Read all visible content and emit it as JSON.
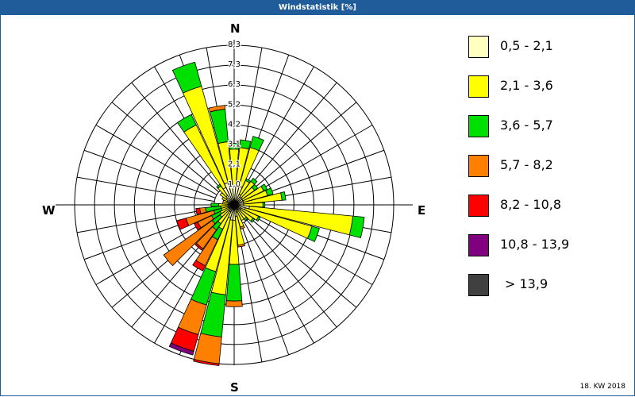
{
  "title": "Windstatistik [%]",
  "footer": "18. KW 2018",
  "chart_data": {
    "type": "windrose",
    "title": "Windstatistik [%]",
    "compass": {
      "n": "N",
      "e": "E",
      "s": "S",
      "w": "W"
    },
    "rmax": 8.3,
    "ring_labels": [
      "1,0",
      "2,1",
      "3,1",
      "4,2",
      "5,2",
      "6,3",
      "7,3",
      "8,3"
    ],
    "ring_values": [
      1.04,
      2.08,
      3.11,
      4.15,
      5.19,
      6.23,
      7.26,
      8.3
    ],
    "classes": [
      {
        "label": "0,5 - 2,1",
        "color": "#ffffc0"
      },
      {
        "label": "2,1 - 3,6",
        "color": "#ffff00"
      },
      {
        "label": "3,6 - 5,7",
        "color": "#00e000"
      },
      {
        "label": "5,7 - 8,2",
        "color": "#ff8000"
      },
      {
        "label": "8,2 - 10,8",
        "color": "#ff0000"
      },
      {
        "label": "10,8 - 13,9",
        "color": "#800080"
      },
      {
        "label": "> 13,9",
        "color": "#404040"
      }
    ],
    "directions_deg": [
      0,
      10,
      20,
      30,
      40,
      50,
      60,
      70,
      80,
      90,
      100,
      110,
      120,
      130,
      140,
      150,
      160,
      170,
      180,
      190,
      200,
      210,
      220,
      230,
      240,
      250,
      260,
      270,
      280,
      290,
      300,
      310,
      320,
      330,
      340,
      350
    ],
    "values_by_class": [
      [
        1.0,
        1.9,
        0.3,
        0,
        0,
        0,
        0
      ],
      [
        1.0,
        2.0,
        0.4,
        0,
        0,
        0,
        0
      ],
      [
        1.0,
        2.1,
        0.6,
        0,
        0,
        0,
        0
      ],
      [
        0.6,
        0.8,
        0.1,
        0,
        0,
        0,
        0
      ],
      [
        0.5,
        1.0,
        0.2,
        0,
        0,
        0,
        0
      ],
      [
        0.5,
        0.8,
        0.2,
        0,
        0,
        0,
        0
      ],
      [
        0.5,
        1.2,
        0.2,
        0,
        0,
        0,
        0
      ],
      [
        0.5,
        1.3,
        0.3,
        0,
        0,
        0,
        0
      ],
      [
        0.5,
        2.0,
        0.2,
        0,
        0,
        0,
        0
      ],
      [
        0.5,
        1.0,
        0.1,
        0,
        0,
        0,
        0
      ],
      [
        0.8,
        5.4,
        0.6,
        0,
        0,
        0,
        0
      ],
      [
        0.6,
        3.6,
        0.4,
        0,
        0,
        0,
        0
      ],
      [
        0.4,
        1.0,
        0.1,
        0,
        0,
        0,
        0
      ],
      [
        0.4,
        0.8,
        0.1,
        0,
        0,
        0,
        0
      ],
      [
        0.3,
        0.6,
        0.1,
        0,
        0,
        0,
        0
      ],
      [
        0.3,
        0.6,
        0,
        0,
        0,
        0,
        0
      ],
      [
        0.4,
        0.8,
        0,
        0.1,
        0,
        0,
        0
      ],
      [
        0.6,
        1.5,
        0,
        0.1,
        0,
        0,
        0
      ],
      [
        0.8,
        2.3,
        1.9,
        0.3,
        0,
        0,
        0
      ],
      [
        0.8,
        3.9,
        2.2,
        1.4,
        0.1,
        0,
        0
      ],
      [
        0.7,
        2.9,
        1.8,
        1.6,
        0.9,
        0.2,
        0
      ],
      [
        0.4,
        1.0,
        0.6,
        1.5,
        0.3,
        0,
        0
      ],
      [
        0.4,
        0.8,
        0.4,
        1.2,
        0.1,
        0,
        0
      ],
      [
        0.3,
        0.6,
        0.5,
        3.1,
        0,
        0,
        0
      ],
      [
        0.3,
        0.5,
        0.5,
        0.8,
        0.2,
        0,
        0
      ],
      [
        0.3,
        0.4,
        0.4,
        1.5,
        0.5,
        0,
        0
      ],
      [
        0.3,
        0.4,
        0.8,
        0.3,
        0.2,
        0,
        0
      ],
      [
        0.3,
        0.5,
        0.4,
        0,
        0,
        0,
        0
      ],
      [
        0.3,
        0.3,
        0,
        0,
        0,
        0,
        0
      ],
      [
        0.3,
        0.3,
        0,
        0,
        0,
        0,
        0
      ],
      [
        0.4,
        0.3,
        0,
        0,
        0,
        0,
        0
      ],
      [
        0.5,
        0.4,
        0,
        0,
        0,
        0,
        0
      ],
      [
        0.6,
        0.6,
        0.1,
        0,
        0,
        0,
        0
      ],
      [
        1.0,
        3.6,
        0.6,
        0,
        0,
        0,
        0
      ],
      [
        1.2,
        5.2,
        1.3,
        0,
        0,
        0,
        0
      ],
      [
        1.0,
        2.3,
        1.7,
        0.2,
        0,
        0,
        0
      ]
    ]
  }
}
